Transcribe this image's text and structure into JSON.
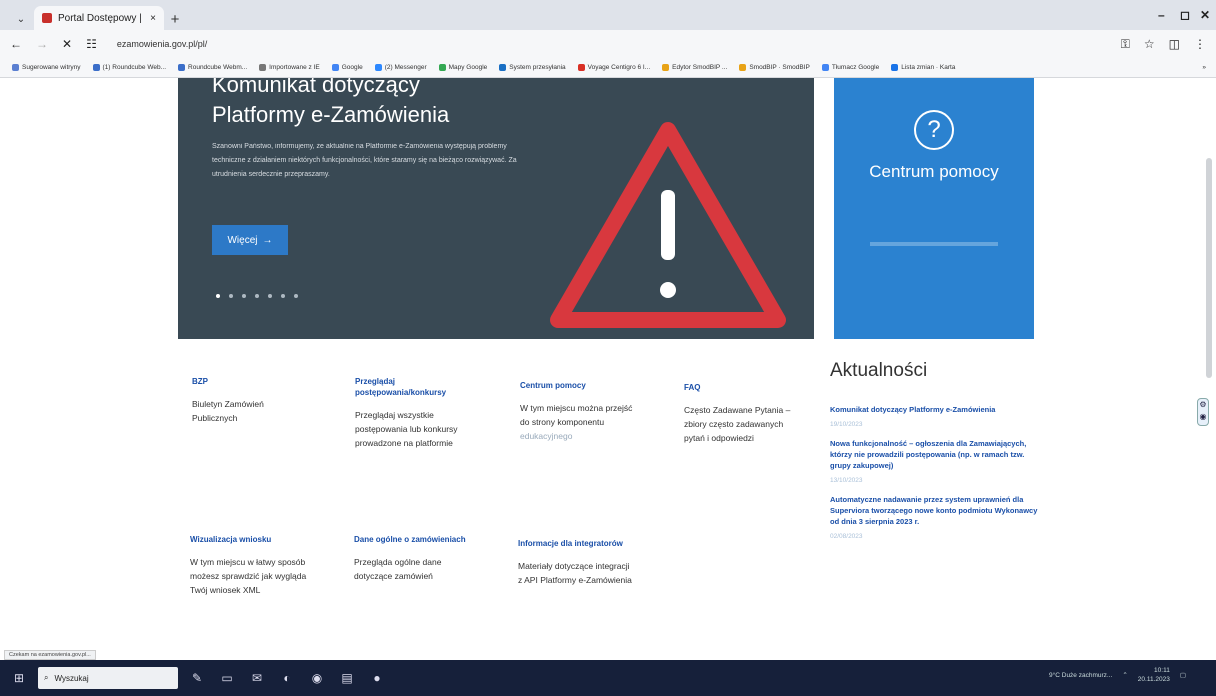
{
  "browser": {
    "tab_title": "Portal Dostępowy |",
    "tab_close": "×",
    "new_tab": "+",
    "url": "ezamowienia.gov.pl/pl/",
    "win_min": "–",
    "win_max": "◻",
    "win_close": "✕",
    "bookmarks": [
      {
        "label": "Sugerowane witryny",
        "color": "#5b7fd1"
      },
      {
        "label": "(1) Roundcube Web...",
        "color": "#3b6ec9"
      },
      {
        "label": "Roundcube Webm...",
        "color": "#3b6ec9"
      },
      {
        "label": "Importowane z IE",
        "color": "#777"
      },
      {
        "label": "Google",
        "color": "#4285f4"
      },
      {
        "label": "(2) Messenger",
        "color": "#2d88ff"
      },
      {
        "label": "Mapy Google",
        "color": "#34a853"
      },
      {
        "label": "System przesyłania",
        "color": "#1a6fc4"
      },
      {
        "label": "Voyage Centigro 6 I...",
        "color": "#d93025"
      },
      {
        "label": "Edytor SmodBIP ...",
        "color": "#e8a317"
      },
      {
        "label": "SmodBIP · SmodBIP",
        "color": "#e8a317"
      },
      {
        "label": "Tłumacz Google",
        "color": "#4285f4"
      },
      {
        "label": "Lista zmian · Karta",
        "color": "#1a73e8"
      }
    ],
    "bookmarks_more": "»"
  },
  "hero": {
    "title": "Komunikat dotyczący Platformy e-Zamówienia",
    "body": "Szanowni Państwo, informujemy, że aktualnie na Platformie e-Zamówienia występują problemy techniczne z działaniem niektórych funkcjonalności, które staramy się na bieżąco rozwiązywać. Za utrudnienia serdecznie przepraszamy.",
    "more_label": "Więcej",
    "more_arrow": "→"
  },
  "help": {
    "icon": "?",
    "title": "Centrum pomocy"
  },
  "cards": [
    {
      "title": "BZP",
      "body": "Biuletyn Zamówień Publicznych",
      "muted": ""
    },
    {
      "title": "Przeglądaj postępowania/konkursy",
      "body": "Przeglądaj wszystkie postępowania lub konkursy prowadzone na platformie",
      "muted": ""
    },
    {
      "title": "Centrum pomocy",
      "body": "W tym miejscu można przejść do strony komponentu",
      "muted": "edukacyjnego"
    },
    {
      "title": "FAQ",
      "body": "Często Zadawane Pytania – zbiory często zadawanych pytań i odpowiedzi",
      "muted": ""
    },
    {
      "title": "Wizualizacja wniosku",
      "body": "W tym miejscu w łatwy sposób możesz sprawdzić jak wygląda Twój wniosek XML",
      "muted": ""
    },
    {
      "title": "Dane ogólne o zamówieniach",
      "body": "Przegląda ogólne dane dotyczące zamówień",
      "muted": ""
    },
    {
      "title": "Informacje dla integratorów",
      "body": "Materiały dotyczące integracji z API Platformy e-Zamówienia",
      "muted": ""
    }
  ],
  "news": {
    "heading": "Aktualności",
    "items": [
      {
        "title": "Komunikat dotyczący Platformy e-Zamówienia",
        "date": "19/10/2023"
      },
      {
        "title": "Nowa funkcjonalność – ogłoszenia dla Zamawiających, którzy nie prowadzili postępowania (np. w ramach tzw. grupy zakupowej)",
        "date": "13/10/2023"
      },
      {
        "title": "Automatyczne nadawanie przez system uprawnień dla Superviora tworzącego nowe konto podmiotu Wykonawcy od dnia 3 sierpnia 2023 r.",
        "date": "02/08/2023"
      }
    ]
  },
  "status_text": "Czekam na ezamowienia.gov.pl...",
  "taskbar": {
    "search_placeholder": "Wyszukaj",
    "weather": "9°C  Duże zachmurz...",
    "time": "10:11",
    "date": "20.11.2023"
  }
}
